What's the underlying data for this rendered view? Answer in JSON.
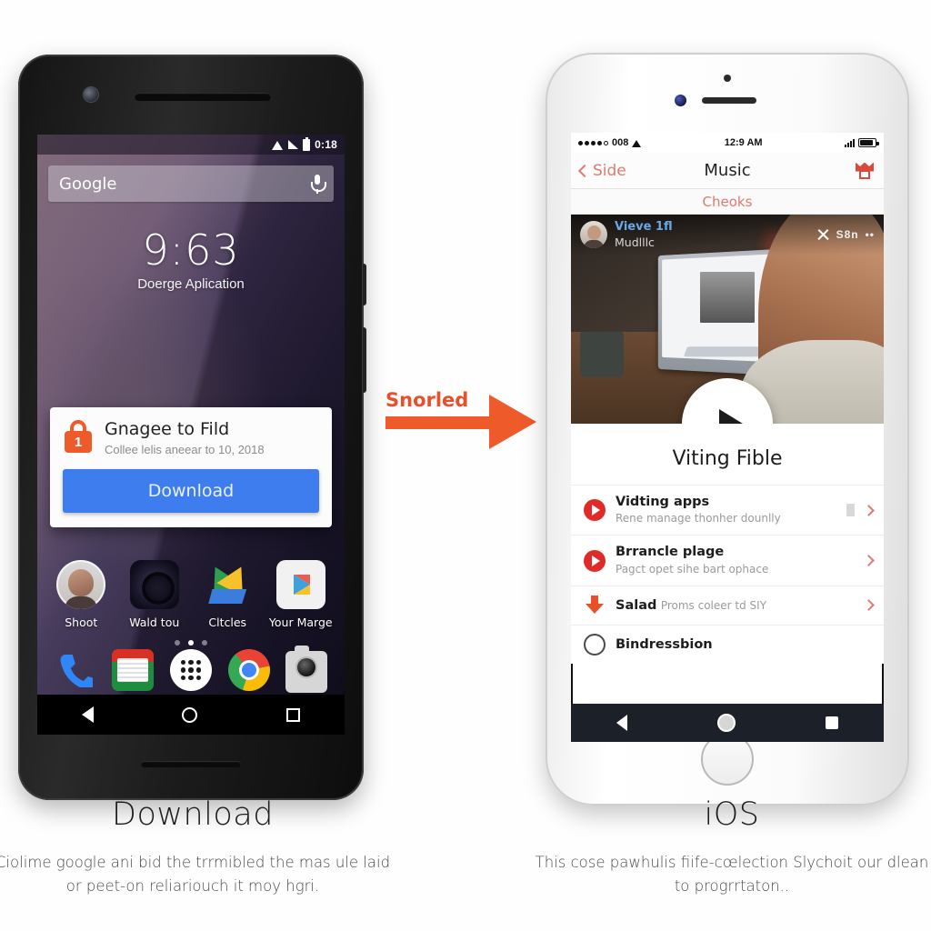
{
  "android": {
    "status": {
      "time": "0:18",
      "wifi_icon": "wifi-icon",
      "signal_icon": "signal-icon",
      "battery_icon": "battery-icon"
    },
    "search": {
      "placeholder": "Google",
      "mic_icon": "mic-icon"
    },
    "lockscreen": {
      "clock": "9:63",
      "subtitle": "Doerge Aplication"
    },
    "dialog": {
      "lock_icon": "lock-icon",
      "badge": "1",
      "title": "Gnagee to Fild",
      "subtitle": "Collee lelis aneear to 10, 2018",
      "button": "Download"
    },
    "apps": [
      {
        "label": "Shoot",
        "icon": "avatar-icon"
      },
      {
        "label": "Wald tou",
        "icon": "rainbow-ring-icon"
      },
      {
        "label": "Cltcles",
        "icon": "google-drive-icon"
      },
      {
        "label": "Your Marge",
        "icon": "play-store-icon"
      }
    ],
    "page_dots": 3,
    "active_dot": 1,
    "dock": [
      {
        "icon": "phone-icon"
      },
      {
        "icon": "news-icon"
      },
      {
        "icon": "app-drawer-icon"
      },
      {
        "icon": "chrome-icon"
      },
      {
        "icon": "camera-icon"
      }
    ],
    "navbar": {
      "back": "back-icon",
      "home": "home-icon",
      "recents": "recents-icon"
    }
  },
  "arrow": {
    "label": "Snorled",
    "color": "#e8502a"
  },
  "ios": {
    "status": {
      "carrier": "008",
      "time": "12:9 AM",
      "wifi_icon": "wifi-icon",
      "battery_icon": "battery-icon"
    },
    "navbar": {
      "back": "Side",
      "title": "Music",
      "action_icon": "crown-icon"
    },
    "subbar": {
      "label": "Cheoks"
    },
    "video": {
      "user": "Vieve 1fl",
      "subtitle": "Mudlllc",
      "close_icon": "close-icon",
      "tag": "S8n",
      "play_icon": "play-icon"
    },
    "heading": "Viting Fible",
    "list": [
      {
        "icon": "play-circle-icon",
        "title": "Vidting apps",
        "subtitle": "Rene manage thonher dounlly",
        "badge": true
      },
      {
        "icon": "play-circle-icon",
        "title": "Brrancle plage",
        "subtitle": "Pagct opet sihe bart ophace",
        "badge": false
      },
      {
        "icon": "download-icon",
        "title": "Salad",
        "subtitle": "Proms coleer td SIY",
        "badge": false
      },
      {
        "icon": "circle-icon",
        "title": "Bindressbion",
        "subtitle": "",
        "badge": false
      }
    ],
    "bottomnav": {
      "back": "back-icon",
      "home": "home-icon",
      "recents": "recents-icon"
    }
  },
  "captions": {
    "left": {
      "title": "Download",
      "body": "Ciolime google ani bid the trrmibled the mas ule laid or peet-on reliariouch it moy hgri."
    },
    "right": {
      "title": "iOS",
      "body": "This cose pawhulis fiife-cœlection Slychoit our dlean to progrrtaton.."
    }
  }
}
